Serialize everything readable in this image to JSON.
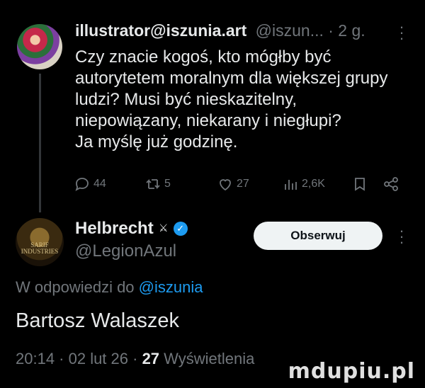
{
  "tweet1": {
    "display_name": "illustrator@iszunia.art",
    "meta": "@iszun... · 2 g.",
    "text_lines": [
      "Czy znacie kogoś, kto mógłby być",
      "autorytetem moralnym dla większej grupy",
      "ludzi? Musi być nieskazitelny,",
      "niepowiązany, niekarany i niegłupi?",
      "Ja myślę już godzinę."
    ],
    "actions": {
      "replies": "44",
      "reposts": "5",
      "likes": "27",
      "views": "2,6K"
    }
  },
  "tweet2": {
    "display_name": "Helbrecht",
    "flag_glyph": "⚔",
    "avatar_text": "SARIF\nINDUSTRIES",
    "handle": "@LegionAzul",
    "follow_label": "Obserwuj",
    "reply_prefix": "W odpowiedzi do",
    "reply_mention": "@iszunia",
    "text": "Bartosz Walaszek",
    "timestamp": "20:14 · 02 lut 26 · ",
    "view_count": "27",
    "view_label": " Wyświetlenia"
  },
  "watermark": "mdupiu.pl",
  "colors": {
    "background": "#000000",
    "text": "#e7e9ea",
    "muted": "#71767b",
    "accent": "#1d9bf0",
    "button_bg": "#eff3f4"
  },
  "icons": [
    "reply-icon",
    "repost-icon",
    "like-icon",
    "views-icon",
    "bookmark-icon",
    "share-icon",
    "more-icon",
    "verified-icon"
  ]
}
